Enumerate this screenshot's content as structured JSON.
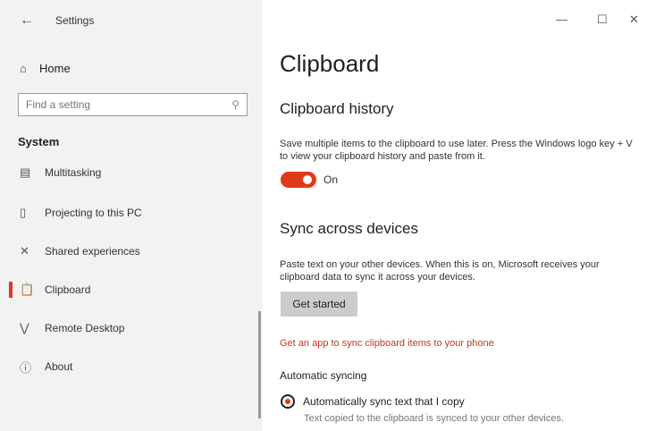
{
  "window": {
    "title": "Settings",
    "back_icon": "back-arrow-icon",
    "controls": {
      "minimize": "—",
      "maximize": "☐",
      "close": "✕"
    }
  },
  "sidebar": {
    "home": {
      "icon": "home-icon",
      "label": "Home"
    },
    "search": {
      "placeholder": "Find a setting",
      "icon": "search-icon"
    },
    "section": "System",
    "items": [
      {
        "icon": "multitasking-icon",
        "label": "Multitasking",
        "active": false
      },
      {
        "icon": "projecting-icon",
        "label": "Projecting to this PC",
        "active": false
      },
      {
        "icon": "shared-experiences-icon",
        "label": "Shared experiences",
        "active": false
      },
      {
        "icon": "clipboard-icon",
        "label": "Clipboard",
        "active": true
      },
      {
        "icon": "remote-desktop-icon",
        "label": "Remote Desktop",
        "active": false
      },
      {
        "icon": "info-icon",
        "label": "About",
        "active": false
      }
    ]
  },
  "main": {
    "title": "Clipboard",
    "history": {
      "heading": "Clipboard history",
      "description": "Save multiple items to the clipboard to use later. Press the Windows logo key + V to view your clipboard history and paste from it.",
      "toggle_state": "On"
    },
    "sync": {
      "heading": "Sync across devices",
      "description": "Paste text on your other devices. When this is on, Microsoft receives your clipboard data to sync it across your devices.",
      "button": "Get started",
      "link": "Get an app to sync clipboard items to your phone",
      "auto_sync_label": "Automatic syncing",
      "radio_label": "Automatically sync text that I copy",
      "radio_hint": "Text copied to the clipboard is synced to your other devices."
    }
  },
  "colors": {
    "accent": "#e0391a",
    "sidebar_bg": "#f2f2f2",
    "link": "#c23a1a"
  }
}
